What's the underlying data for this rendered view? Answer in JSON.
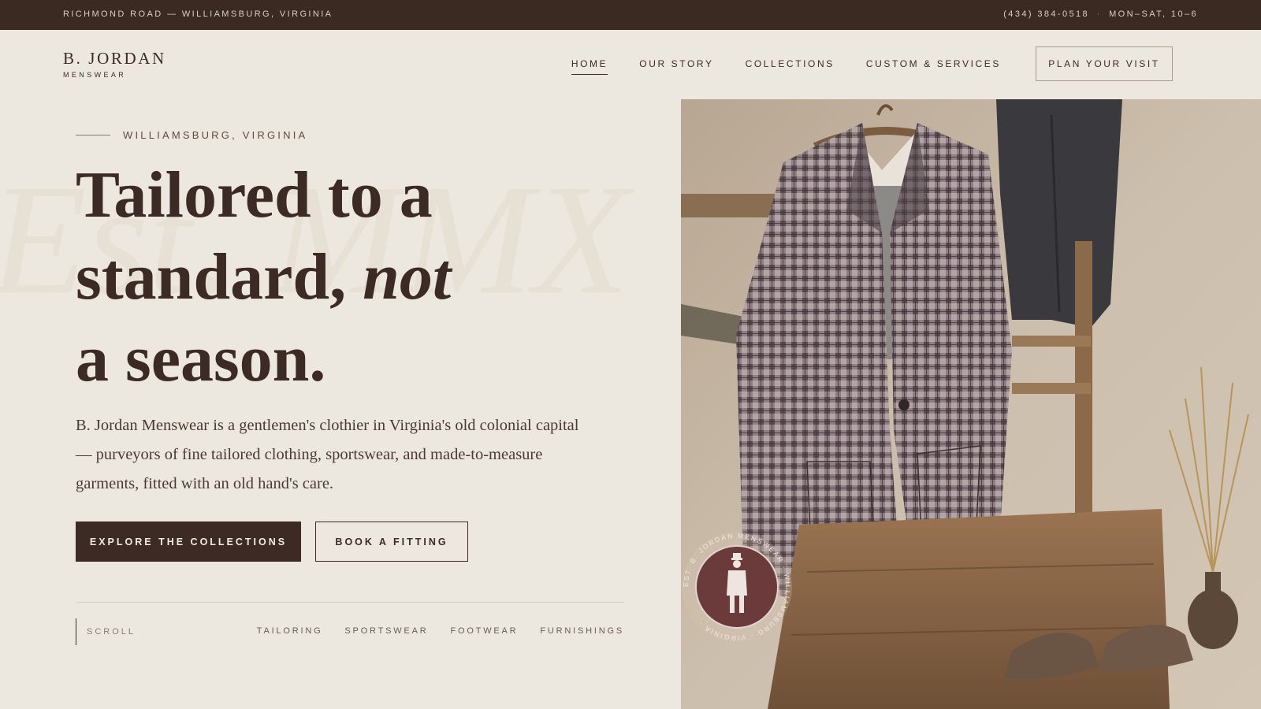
{
  "topbar": {
    "address": "RICHMOND ROAD — WILLIAMSBURG, VIRGINIA",
    "phone": "(434) 384-0518",
    "separator": "·",
    "hours": "MON–SAT, 10–6"
  },
  "brand": {
    "name": "B. JORDAN",
    "subtitle": "MENSWEAR"
  },
  "nav": {
    "items": [
      {
        "label": "HOME",
        "active": true
      },
      {
        "label": "OUR STORY",
        "active": false
      },
      {
        "label": "COLLECTIONS",
        "active": false
      },
      {
        "label": "CUSTOM & SERVICES",
        "active": false
      }
    ],
    "cta": "PLAN YOUR VISIT"
  },
  "hero": {
    "watermark": "Est. MMX",
    "eyebrow": "WILLIAMSBURG, VIRGINIA",
    "headline_line1": "Tailored to a",
    "headline_line2_start": "standard, ",
    "headline_line2_em": "not",
    "headline_line3": "a season.",
    "intro": "B. Jordan Menswear is a gentlemen's clothier in Virginia's old colonial capital — purveyors of fine tailored clothing, sportswear, and made-to-measure garments, fitted with an old hand's care.",
    "primary_cta": "EXPLORE THE COLLECTIONS",
    "secondary_cta": "BOOK A FITTING",
    "scroll_label": "SCROLL",
    "categories": [
      "TAILORING",
      "SPORTSWEAR",
      "FOOTWEAR",
      "FURNISHINGS"
    ]
  },
  "badge": {
    "ring_text": "EST. B. JORDAN MENSWEAR · WILLIAMSBURG · VIRGINIA ·"
  },
  "colors": {
    "background": "#ede8df",
    "topbar": "#3a2a22",
    "primary": "#3d2a24",
    "badge": "#6b3a3a"
  }
}
